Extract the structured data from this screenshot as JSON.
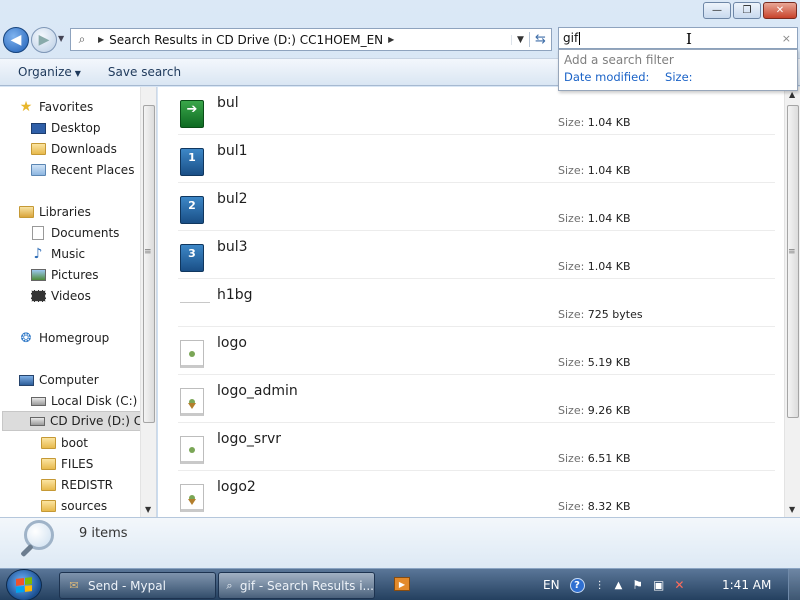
{
  "window": {
    "minimize_glyph": "—",
    "restore_glyph": "❐",
    "close_glyph": "✕"
  },
  "address": {
    "path": "Search Results in CD Drive (D:) CC1HOEM_EN",
    "search_value": "gif",
    "search_clear": "×"
  },
  "search_popup": {
    "hint": "Add a search filter",
    "filter1": "Date modified:",
    "filter2": "Size:"
  },
  "toolbar": {
    "organize": "Organize",
    "save_search": "Save search"
  },
  "sidebar": {
    "favorites": "Favorites",
    "desktop": "Desktop",
    "downloads": "Downloads",
    "recent_places": "Recent Places",
    "libraries": "Libraries",
    "documents": "Documents",
    "music": "Music",
    "pictures": "Pictures",
    "videos": "Videos",
    "homegroup": "Homegroup",
    "computer": "Computer",
    "local_disk": "Local Disk (C:)",
    "cd_drive": "CD Drive (D:) CC",
    "boot": "boot",
    "files": "FILES",
    "redistr": "REDISTR",
    "sources": "sources"
  },
  "size_label": "Size:",
  "files": [
    {
      "name": "bul",
      "size": "1.04 KB",
      "icon": "green-arrow-icon"
    },
    {
      "name": "bul1",
      "size": "1.04 KB",
      "icon": "blue-1-icon"
    },
    {
      "name": "bul2",
      "size": "1.04 KB",
      "icon": "blue-2-icon"
    },
    {
      "name": "bul3",
      "size": "1.04 KB",
      "icon": "blue-3-icon"
    },
    {
      "name": "h1bg",
      "size": "725 bytes",
      "icon": "line-icon"
    },
    {
      "name": "logo",
      "size": "5.19 KB",
      "icon": "image-doc-icon"
    },
    {
      "name": "logo_admin",
      "size": "9.26 KB",
      "icon": "image-doc-icon"
    },
    {
      "name": "logo_srvr",
      "size": "6.51 KB",
      "icon": "image-doc-icon"
    },
    {
      "name": "logo2",
      "size": "8.32 KB",
      "icon": "image-doc-icon"
    }
  ],
  "icon_glyphs": {
    "arrow": "➔",
    "one": "1",
    "two": "2",
    "three": "3"
  },
  "details": {
    "item_count": "9 items"
  },
  "taskbar": {
    "task1": "Send - Mypal",
    "task2": "gif - Search Results i...",
    "lang": "EN",
    "help": "?",
    "time": "1:41 AM"
  },
  "colors": {
    "accent": "#1b63c7",
    "taskbar": "#24405f"
  }
}
